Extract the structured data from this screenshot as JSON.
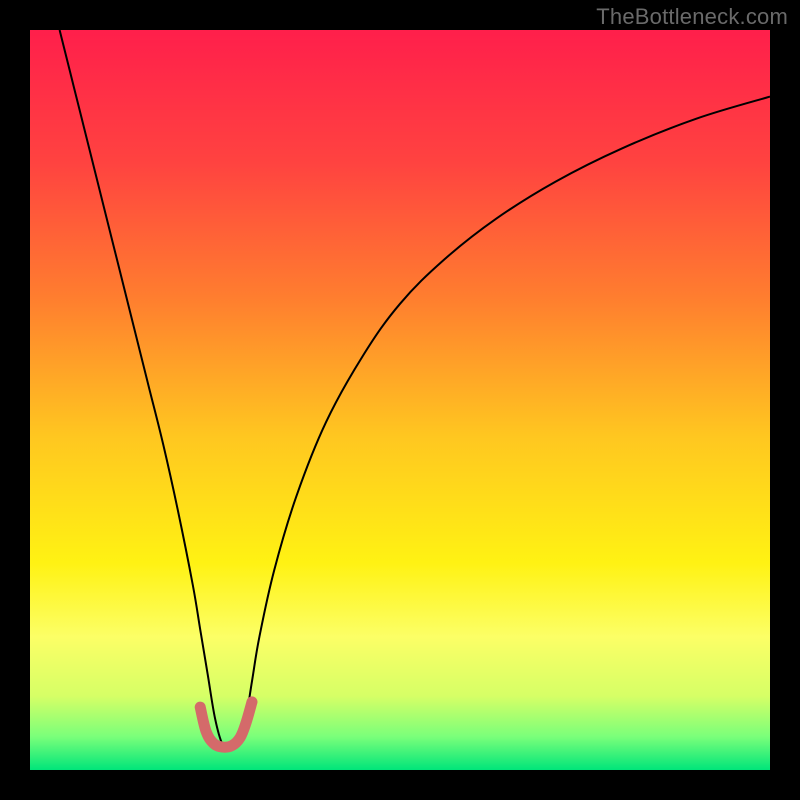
{
  "watermark": "TheBottleneck.com",
  "chart_data": {
    "type": "line",
    "title": "",
    "xlabel": "",
    "ylabel": "",
    "xlim": [
      0,
      100
    ],
    "ylim": [
      0,
      100
    ],
    "grid": false,
    "legend": false,
    "background_gradient_stops": [
      {
        "offset": 0.0,
        "color": "#ff1f4b"
      },
      {
        "offset": 0.18,
        "color": "#ff4340"
      },
      {
        "offset": 0.36,
        "color": "#ff7d2f"
      },
      {
        "offset": 0.55,
        "color": "#ffc720"
      },
      {
        "offset": 0.72,
        "color": "#fff213"
      },
      {
        "offset": 0.82,
        "color": "#fcff66"
      },
      {
        "offset": 0.9,
        "color": "#d6ff66"
      },
      {
        "offset": 0.955,
        "color": "#7aff7a"
      },
      {
        "offset": 1.0,
        "color": "#00e57a"
      }
    ],
    "series": [
      {
        "name": "bottleneck-curve",
        "color": "#000000",
        "width": 2.0,
        "x": [
          4,
          6,
          8,
          10,
          12,
          14,
          16,
          18,
          20,
          22,
          23,
          24,
          25,
          26,
          27,
          28,
          29,
          30,
          31,
          33,
          36,
          40,
          45,
          50,
          56,
          63,
          71,
          80,
          90,
          100
        ],
        "y": [
          100,
          92,
          84,
          76,
          68,
          60,
          52,
          44,
          35,
          25,
          19,
          13,
          7,
          3.5,
          3,
          3.5,
          6,
          12,
          18,
          27,
          37,
          47,
          56,
          63,
          69,
          74.5,
          79.5,
          84,
          88,
          91
        ]
      },
      {
        "name": "optimal-marker",
        "color": "#d46a6a",
        "width": 11,
        "linecap": "round",
        "x": [
          23.0,
          23.8,
          24.8,
          26.0,
          27.3,
          28.4,
          29.2,
          30.0
        ],
        "y": [
          8.5,
          5.2,
          3.6,
          3.1,
          3.3,
          4.4,
          6.4,
          9.2
        ]
      }
    ]
  }
}
